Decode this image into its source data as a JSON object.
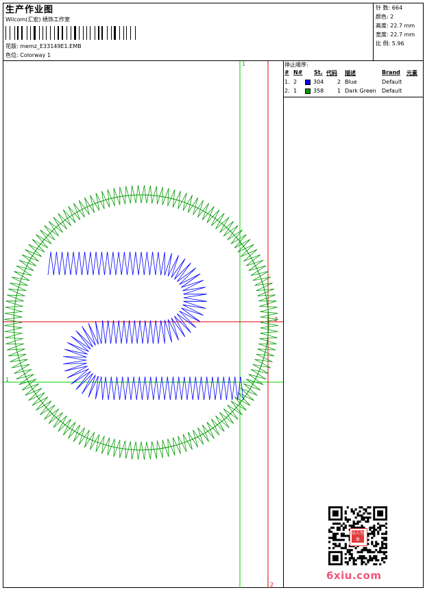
{
  "header": {
    "title": "生产作业图",
    "company": "Wilcom(汇宏) 绣饰工作室",
    "design_label": "花版:",
    "design_file": "memz_E33149E1.EMB",
    "colorway_label": "色位:",
    "colorway": "Colorway 1"
  },
  "stats": [
    {
      "label": "针 数:",
      "value": "664"
    },
    {
      "label": "颜色:",
      "value": "2"
    },
    {
      "label": "高度:",
      "value": "22.7 mm"
    },
    {
      "label": "宽度:",
      "value": "22.7 mm"
    },
    {
      "label": "比 例:",
      "value": "5.96"
    }
  ],
  "stop_sequence": {
    "title": "停止顺序:",
    "headers": {
      "hash": "#",
      "n": "N#",
      "st": "St.",
      "code": "代码",
      "desc": "描述",
      "brand": "Brand",
      "element": "元素"
    },
    "rows": [
      {
        "idx": "1.",
        "n": "2",
        "color": "#0000ff",
        "st": "304",
        "code": "2",
        "desc": "Blue",
        "brand": "Default"
      },
      {
        "idx": "2.",
        "n": "1",
        "color": "#009900",
        "st": "358",
        "code": "1",
        "desc": "Dark Green",
        "brand": "Default"
      }
    ]
  },
  "guides": {
    "green_v_label": "1",
    "green_h_label": "1",
    "red_h_label": "2",
    "red_v_label": "2"
  },
  "colors": {
    "outer_ring": "#009900",
    "inner_mark": "#0000ff",
    "guide_green": "#00cc00",
    "guide_red": "#dd0000"
  },
  "watermark": {
    "text": "6xiu.com",
    "qr_seal_text": "以人为本"
  }
}
